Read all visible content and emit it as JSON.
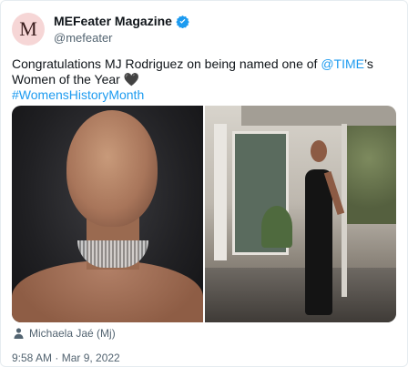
{
  "account": {
    "avatar_letter": "M",
    "display_name": "MEFeater Magazine",
    "handle": "@mefeater",
    "verified": true
  },
  "tweet": {
    "text_before": "Congratulations MJ Rodriguez on being named one of ",
    "mention": "@TIME",
    "text_after": "’s Women of the Year 🖤",
    "hashtag": "#WomensHistoryMonth"
  },
  "media": {
    "photos": [
      {
        "icon": "portrait-photo"
      },
      {
        "icon": "full-length-photo"
      }
    ],
    "credit": "Michaela Jaé (Mj)"
  },
  "meta": {
    "timestamp": "9:58 AM · Mar 9, 2022"
  },
  "colors": {
    "link": "#1d9bf0",
    "secondary_text": "#536471",
    "verified": "#1d9bf0",
    "avatar_bg": "#f6d6d6"
  }
}
